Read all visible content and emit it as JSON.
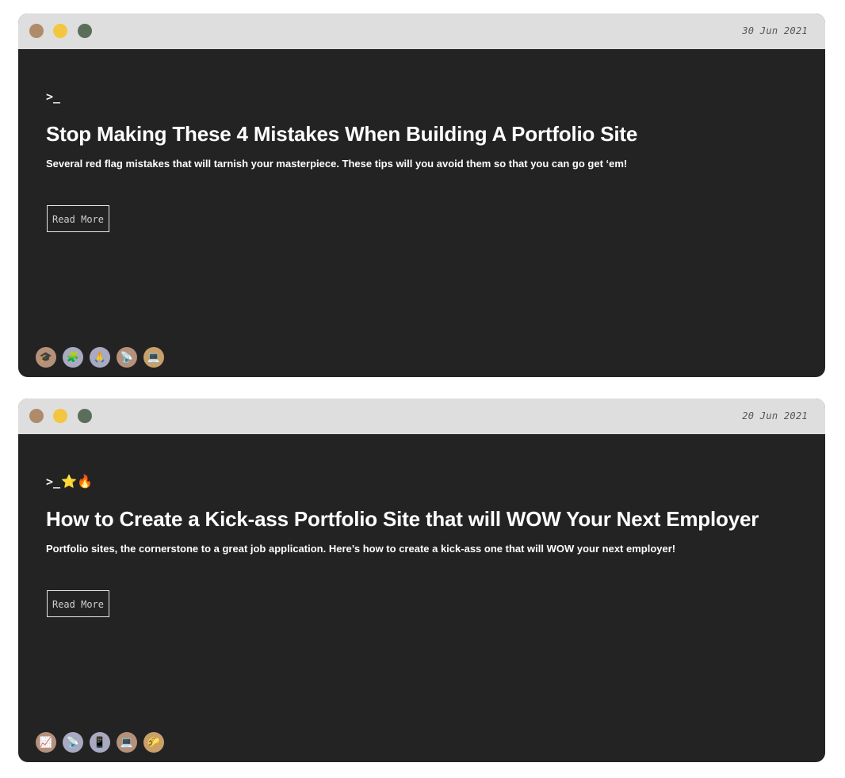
{
  "posts": [
    {
      "date": "30 Jun 2021",
      "prompt": ">_",
      "prompt_emoji": "",
      "title": "Stop Making These 4 Mistakes When Building A Portfolio Site",
      "excerpt": "Several red flag mistakes that will tarnish your masterpiece. These tips will you avoid them so that you can go get ‘em!",
      "read_more": "Read More",
      "tags": [
        {
          "icon": "graduation-cap-icon",
          "glyph": "🎓"
        },
        {
          "icon": "puzzle-icon",
          "glyph": "🧩"
        },
        {
          "icon": "praying-hands-icon",
          "glyph": "🙏"
        },
        {
          "icon": "satellite-dish-icon",
          "glyph": "📡"
        },
        {
          "icon": "laptop-icon",
          "glyph": "💻"
        }
      ]
    },
    {
      "date": "20 Jun 2021",
      "prompt": ">_",
      "prompt_emoji": "⭐🔥",
      "title": "How to Create a Kick-ass Portfolio Site that will WOW Your Next Employer",
      "excerpt": "Portfolio sites, the cornerstone to a great job application. Here’s how to create a kick-ass one that will WOW your next employer!",
      "read_more": "Read More",
      "tags": [
        {
          "icon": "chart-icon",
          "glyph": "📈"
        },
        {
          "icon": "satellite-dish-icon",
          "glyph": "📡"
        },
        {
          "icon": "mobile-phone-icon",
          "glyph": "📱"
        },
        {
          "icon": "laptop-icon",
          "glyph": "💻"
        },
        {
          "icon": "taco-icon",
          "glyph": "🌮"
        }
      ]
    }
  ],
  "colors": {
    "card_bg": "#232323",
    "titlebar_bg": "#dedede",
    "dot_close": "#b08b6b",
    "dot_minimize": "#f3c63f",
    "dot_maximize": "#5b6e5a"
  }
}
